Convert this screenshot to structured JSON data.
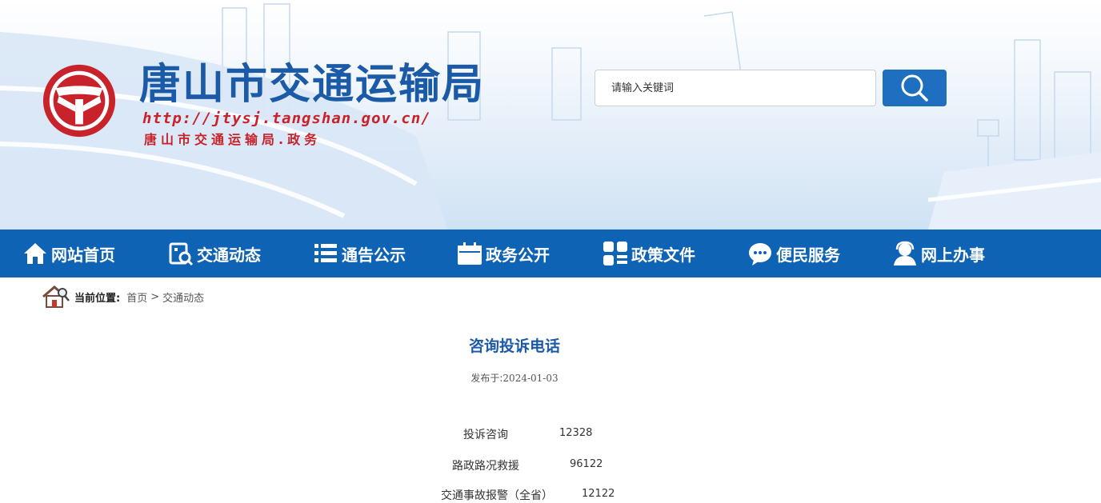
{
  "header": {
    "site_name": "唐山市交通运输局",
    "site_url": "http://jtysj.tangshan.gov.cn/",
    "site_sub": "唐山市交通运输局.政务",
    "emblem_icon": "transport-emblem-icon",
    "accent_color": "#1b5aa6",
    "emblem_color": "#c8222b"
  },
  "search": {
    "placeholder": "请输入关键词",
    "button_icon": "search-icon"
  },
  "nav": {
    "background": "#0f63b4",
    "items": [
      {
        "label": "网站首页",
        "icon": "home-icon"
      },
      {
        "label": "交通动态",
        "icon": "news-search-icon"
      },
      {
        "label": "通告公示",
        "icon": "list-icon"
      },
      {
        "label": "政务公开",
        "icon": "calendar-icon"
      },
      {
        "label": "政策文件",
        "icon": "grid-icon"
      },
      {
        "label": "便民服务",
        "icon": "chat-bubble-icon"
      },
      {
        "label": "网上办事",
        "icon": "user-service-icon"
      }
    ]
  },
  "breadcrumb": {
    "label": "当前位置:",
    "items": [
      "首页",
      "交通动态"
    ],
    "separator": ">",
    "icon": "house-magnifier-icon"
  },
  "article": {
    "title": "咨询投诉电话",
    "pub_label": "发布于:",
    "pub_date": "2024-01-03",
    "rows": [
      {
        "name": "投诉咨询",
        "number": "12328"
      },
      {
        "name": "路政路况救援",
        "number": "96122"
      },
      {
        "name": "交通事故报警（全省）",
        "number": "12122"
      }
    ]
  }
}
